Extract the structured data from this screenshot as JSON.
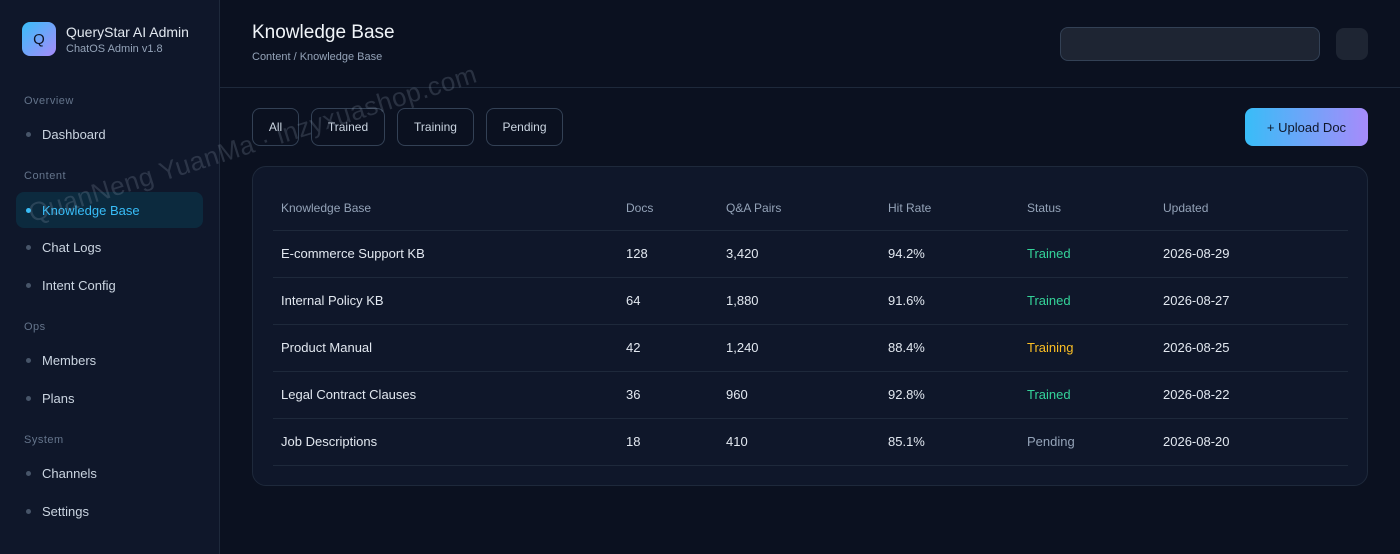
{
  "brand": {
    "logo_letter": "Q",
    "title": "QueryStar AI Admin",
    "subtitle": "ChatOS Admin v1.8"
  },
  "sidebar": {
    "sections": [
      {
        "title": "Overview",
        "items": [
          {
            "label": "Dashboard",
            "active": false
          }
        ]
      },
      {
        "title": "Content",
        "items": [
          {
            "label": "Knowledge Base",
            "active": true
          },
          {
            "label": "Chat Logs",
            "active": false
          },
          {
            "label": "Intent Config",
            "active": false
          }
        ]
      },
      {
        "title": "Ops",
        "items": [
          {
            "label": "Members",
            "active": false
          },
          {
            "label": "Plans",
            "active": false
          }
        ]
      },
      {
        "title": "System",
        "items": [
          {
            "label": "Channels",
            "active": false
          },
          {
            "label": "Settings",
            "active": false
          }
        ]
      }
    ]
  },
  "header": {
    "title": "Knowledge Base",
    "breadcrumb": "Content / Knowledge Base",
    "search_value": ""
  },
  "filters": [
    "All",
    "Trained",
    "Training",
    "Pending"
  ],
  "upload_label": "+ Upload Doc",
  "table": {
    "columns": [
      "Knowledge Base",
      "Docs",
      "Q&A Pairs",
      "Hit Rate",
      "Status",
      "Updated"
    ],
    "rows": [
      [
        "E-commerce Support KB",
        "128",
        "3,420",
        "94.2%",
        "Trained",
        "2026-08-29"
      ],
      [
        "Internal Policy KB",
        "64",
        "1,880",
        "91.6%",
        "Trained",
        "2026-08-27"
      ],
      [
        "Product Manual",
        "42",
        "1,240",
        "88.4%",
        "Training",
        "2026-08-25"
      ],
      [
        "Legal Contract Clauses",
        "36",
        "960",
        "92.8%",
        "Trained",
        "2026-08-22"
      ],
      [
        "Job Descriptions",
        "18",
        "410",
        "85.1%",
        "Pending",
        "2026-08-20"
      ]
    ]
  },
  "watermark": "QuanNeng YuanMa · inzyxuashop.com",
  "colors": {
    "accent": "#38bdf8",
    "accent_2": "#a78bfa",
    "trained": "#34d399",
    "training": "#fbbf24",
    "pending": "#94a3b8"
  }
}
